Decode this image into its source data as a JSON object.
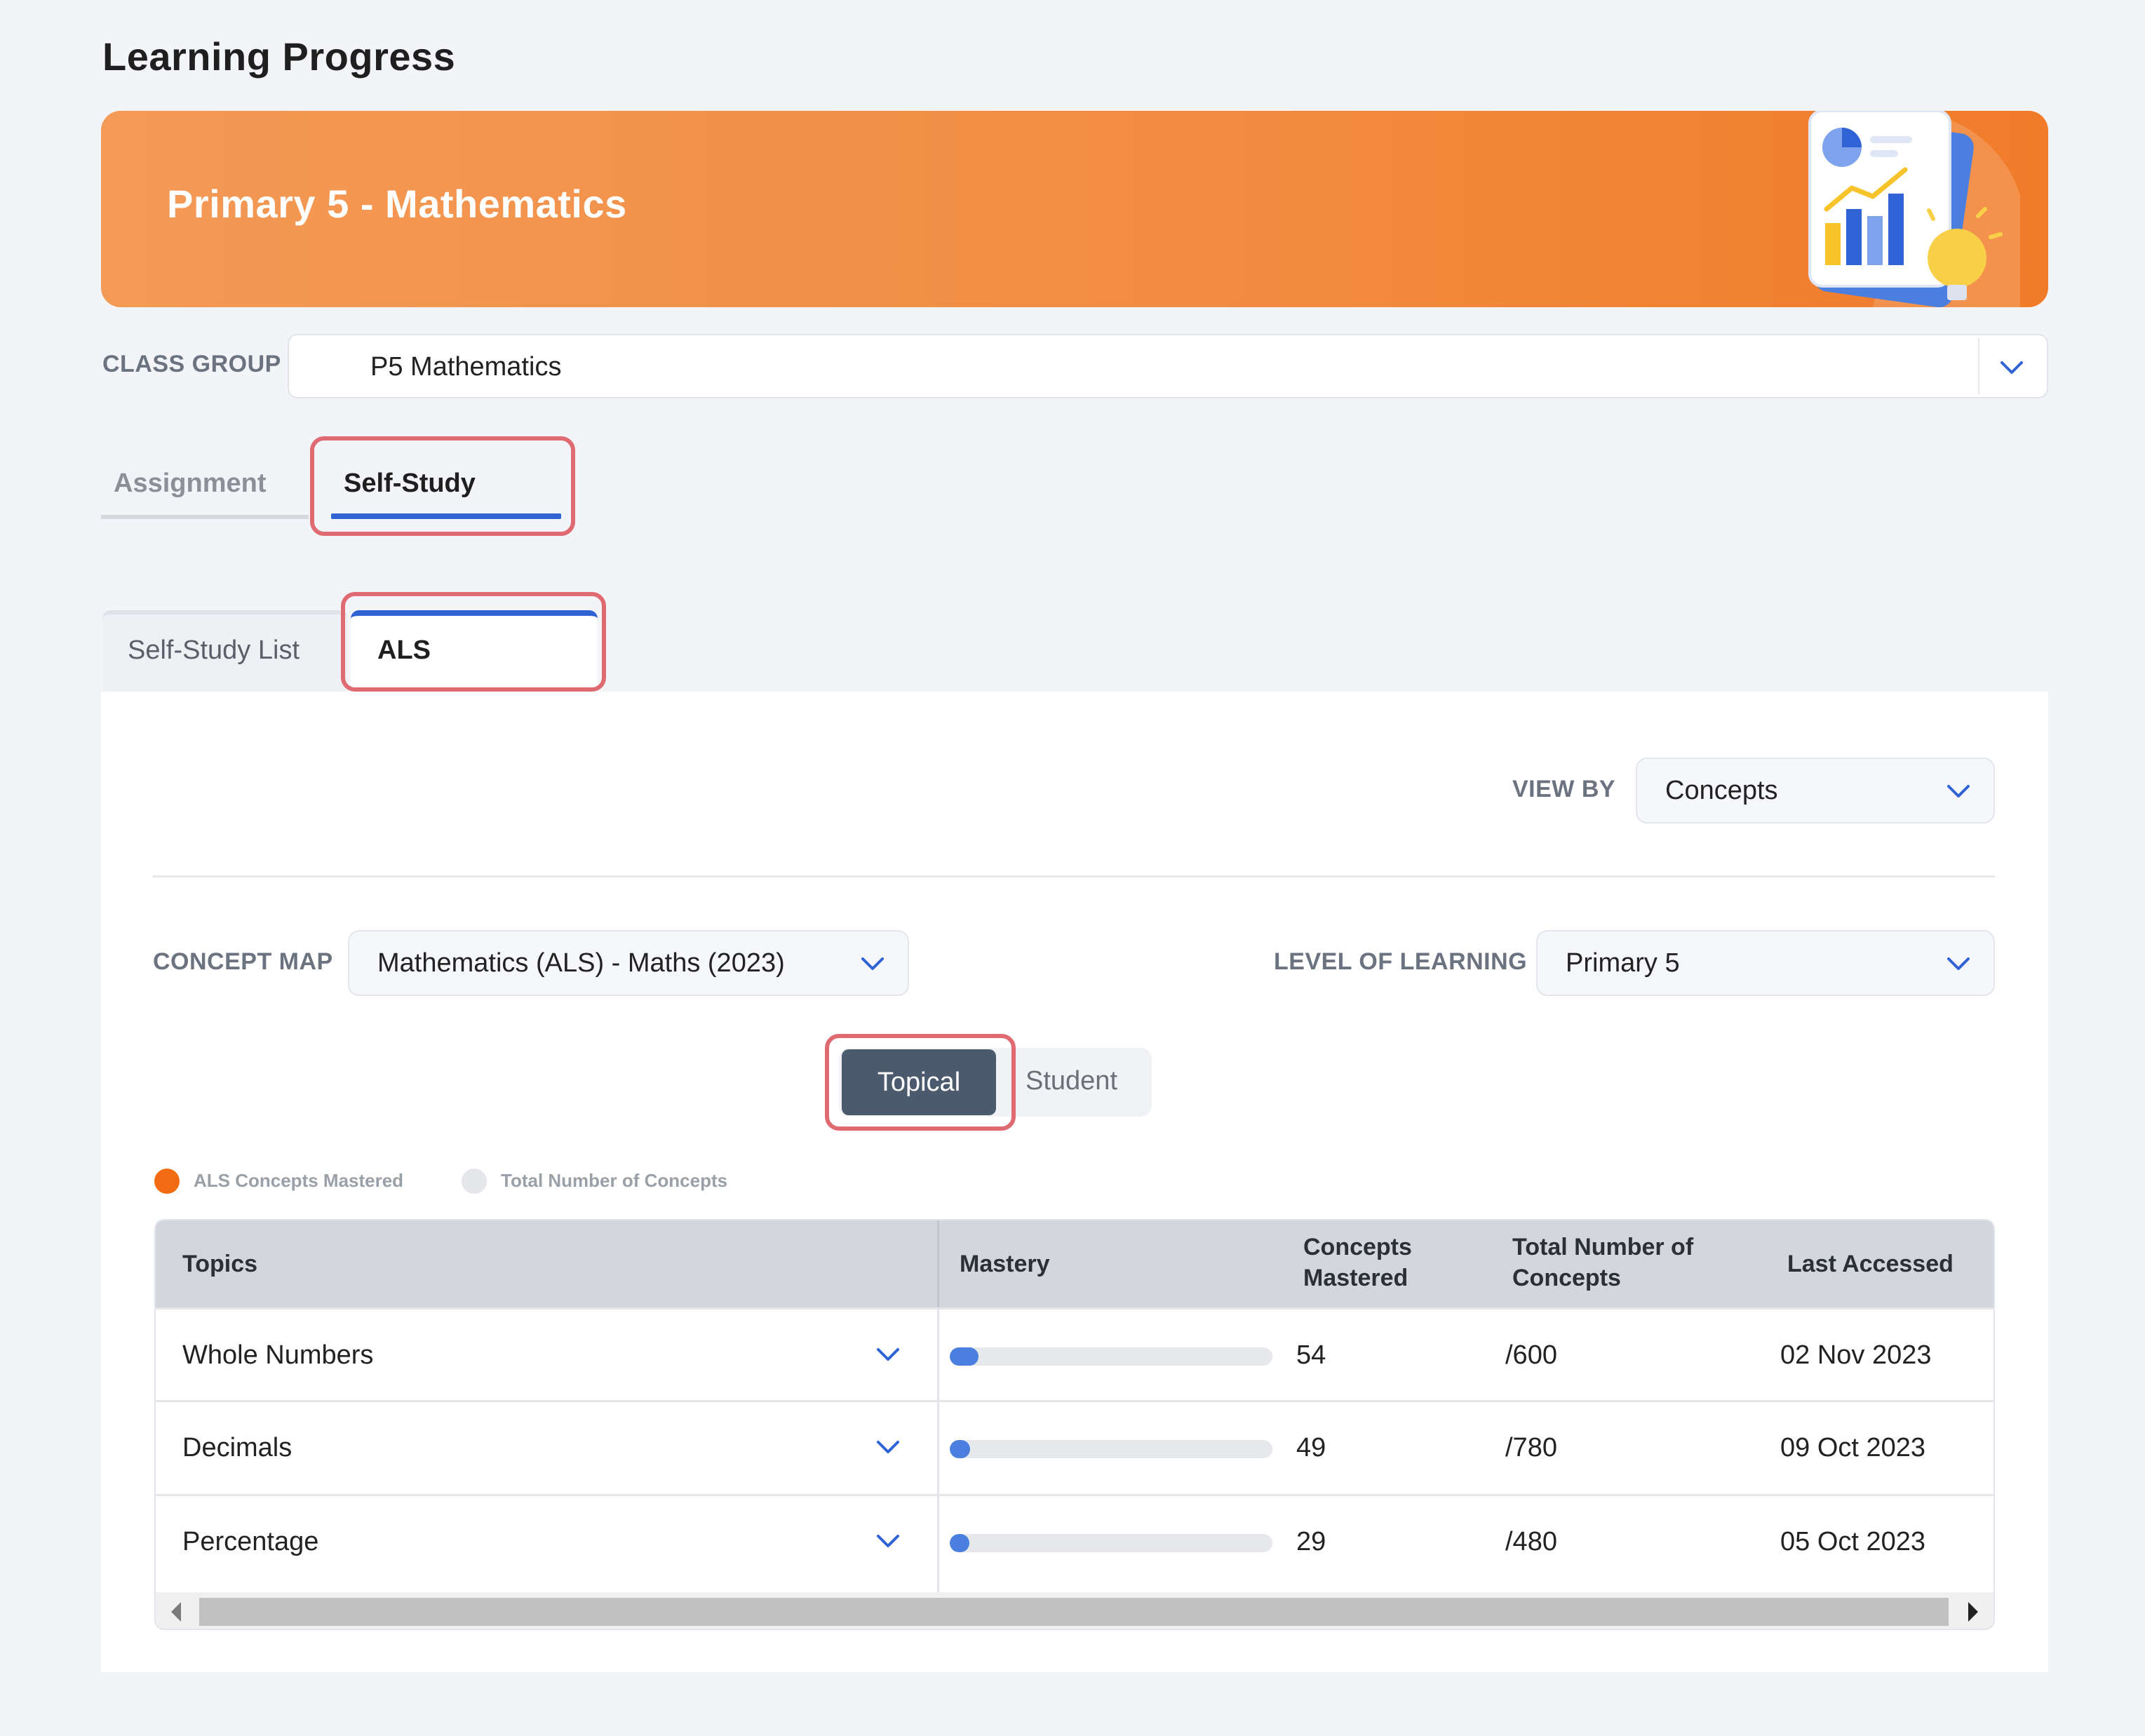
{
  "page": {
    "title": "Learning Progress"
  },
  "banner": {
    "title": "Primary 5 - Mathematics",
    "art_icon": "report-chart-lightbulb-illustration"
  },
  "class_group": {
    "label": "CLASS GROUP",
    "value": "P5 Mathematics",
    "icon": "chevron-down-icon"
  },
  "main_tabs": [
    {
      "label": "Assignment",
      "active": false
    },
    {
      "label": "Self-Study",
      "active": true
    }
  ],
  "sub_tabs": [
    {
      "label": "Self-Study List",
      "active": false
    },
    {
      "label": "ALS",
      "active": true
    }
  ],
  "view_by": {
    "label": "VIEW BY",
    "value": "Concepts"
  },
  "concept_map": {
    "label": "CONCEPT MAP",
    "value": "Mathematics (ALS) - Maths (2023)"
  },
  "level_of_learning": {
    "label": "LEVEL OF LEARNING",
    "value": "Primary 5"
  },
  "toggle": {
    "topical": "Topical",
    "student": "Student",
    "selected": "Topical"
  },
  "legend": {
    "mastered": {
      "label": "ALS Concepts Mastered",
      "color": "#f26a12"
    },
    "total": {
      "label": "Total Number of Concepts",
      "color": "#e6e7ea"
    }
  },
  "table": {
    "headers": {
      "topics": "Topics",
      "mastery": "Mastery",
      "concepts_mastered_1": "Concepts",
      "concepts_mastered_2": "Mastered",
      "total_1": "Total Number of",
      "total_2": "Concepts",
      "last_accessed": "Last Accessed"
    },
    "rows": [
      {
        "topic": "Whole Numbers",
        "mastered": "54",
        "total": "/600",
        "last_accessed": "02 Nov 2023",
        "mastery_fraction": 0.09
      },
      {
        "topic": "Decimals",
        "mastered": "49",
        "total": "/780",
        "last_accessed": "09 Oct 2023",
        "mastery_fraction": 0.063
      },
      {
        "topic": "Percentage",
        "mastered": "29",
        "total": "/480",
        "last_accessed": "05 Oct 2023",
        "mastery_fraction": 0.06
      }
    ]
  },
  "colors": {
    "accent": "#2f63d6",
    "banner": "#f28b3f",
    "highlight": "#e06a72",
    "bar": "#4a7fe0"
  }
}
